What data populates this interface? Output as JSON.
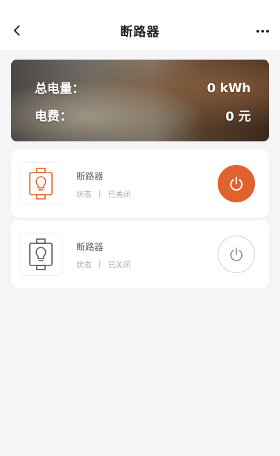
{
  "header": {
    "title": "断路器"
  },
  "summary": {
    "power_label": "总电量：",
    "power_value": "0 kWh",
    "fee_label": "电费：",
    "fee_value": "0 元"
  },
  "devices": [
    {
      "name": "断路器",
      "status_label": "状态",
      "separator": "|",
      "status_value": "已关闭",
      "icon": "breaker-icon",
      "icon_color": "#e2622f",
      "power_button": "active"
    },
    {
      "name": "断路器",
      "status_label": "状态",
      "separator": "|",
      "status_value": "已关闭",
      "icon": "breaker-icon",
      "icon_color": "#555555",
      "power_button": "inactive"
    }
  ],
  "colors": {
    "accent": "#e2622f",
    "background": "#f5f5f7"
  }
}
